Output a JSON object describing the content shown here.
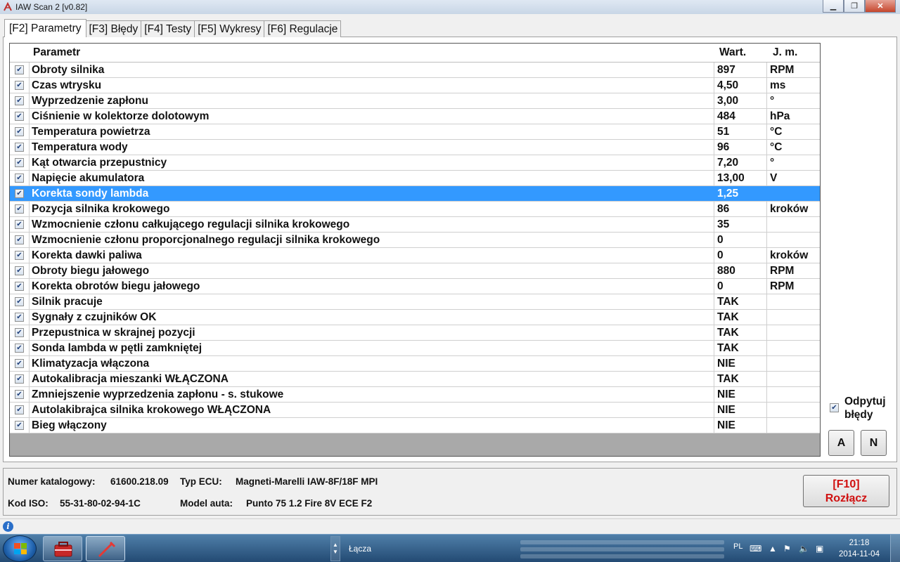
{
  "window": {
    "title": "IAW Scan 2 [v0.82]"
  },
  "tabs": [
    {
      "label": "[F2] Parametry",
      "active": true
    },
    {
      "label": "[F3] Błędy"
    },
    {
      "label": "[F4] Testy"
    },
    {
      "label": "[F5] Wykresy"
    },
    {
      "label": "[F6] Regulacje"
    }
  ],
  "grid": {
    "headers": {
      "param": "Parametr",
      "value": "Wart.",
      "unit": "J. m."
    },
    "rows": [
      {
        "name": "Obroty silnika",
        "value": "897",
        "unit": "RPM"
      },
      {
        "name": "Czas wtrysku",
        "value": "4,50",
        "unit": "ms"
      },
      {
        "name": "Wyprzedzenie zapłonu",
        "value": "3,00",
        "unit": "°"
      },
      {
        "name": "Ciśnienie w kolektorze dolotowym",
        "value": "484",
        "unit": "hPa"
      },
      {
        "name": "Temperatura powietrza",
        "value": "51",
        "unit": "°C"
      },
      {
        "name": "Temperatura wody",
        "value": "96",
        "unit": "°C"
      },
      {
        "name": "Kąt otwarcia przepustnicy",
        "value": "7,20",
        "unit": "°"
      },
      {
        "name": "Napięcie akumulatora",
        "value": "13,00",
        "unit": "V"
      },
      {
        "name": "Korekta sondy lambda",
        "value": "1,25",
        "unit": "",
        "selected": true
      },
      {
        "name": "Pozycja silnika krokowego",
        "value": "86",
        "unit": "kroków"
      },
      {
        "name": "Wzmocnienie członu całkującego regulacji silnika krokowego",
        "value": "35",
        "unit": ""
      },
      {
        "name": "Wzmocnienie członu proporcjonalnego regulacji silnika krokowego",
        "value": "0",
        "unit": ""
      },
      {
        "name": "Korekta dawki paliwa",
        "value": "0",
        "unit": "kroków"
      },
      {
        "name": "Obroty biegu jałowego",
        "value": "880",
        "unit": "RPM"
      },
      {
        "name": "Korekta obrotów biegu jałowego",
        "value": "0",
        "unit": "RPM"
      },
      {
        "name": "Silnik pracuje",
        "value": "TAK",
        "unit": ""
      },
      {
        "name": "Sygnały z czujników OK",
        "value": "TAK",
        "unit": ""
      },
      {
        "name": "Przepustnica w skrajnej pozycji",
        "value": "TAK",
        "unit": ""
      },
      {
        "name": "Sonda lambda w pętli zamkniętej",
        "value": "TAK",
        "unit": ""
      },
      {
        "name": "Klimatyzacja włączona",
        "value": "NIE",
        "unit": ""
      },
      {
        "name": "Autokalibracja mieszanki WŁĄCZONA",
        "value": "TAK",
        "unit": ""
      },
      {
        "name": "Zmniejszenie wyprzedzenia zapłonu - s. stukowe",
        "value": "NIE",
        "unit": ""
      },
      {
        "name": "Autolakibrajca silnika krokowego WŁĄCZONA",
        "value": "NIE",
        "unit": ""
      },
      {
        "name": "Bieg włączony",
        "value": "NIE",
        "unit": ""
      }
    ]
  },
  "poll_errors": {
    "label_line1": "Odpytuj",
    "label_line2": "błędy",
    "checked": true
  },
  "buttons": {
    "a": "A",
    "n": "N",
    "disconnect_line1": "[F10]",
    "disconnect_line2": "Rozłącz"
  },
  "info": {
    "catalog_label": "Numer katalogowy:",
    "catalog_value": "61600.218.09",
    "ecu_label": "Typ ECU:",
    "ecu_value": "Magneti-Marelli IAW-8F/18F MPI",
    "iso_label": "Kod ISO:",
    "iso_value": "55-31-80-02-94-1C",
    "model_label": "Model auta:",
    "model_value": "Punto 75 1.2 Fire 8V ECE F2"
  },
  "taskbar": {
    "folder_label": "Łącza",
    "lang": "PL",
    "time": "21:18",
    "date": "2014-11-04"
  },
  "colors": {
    "selection": "#3399ff",
    "disconnect_text": "#d01010"
  }
}
